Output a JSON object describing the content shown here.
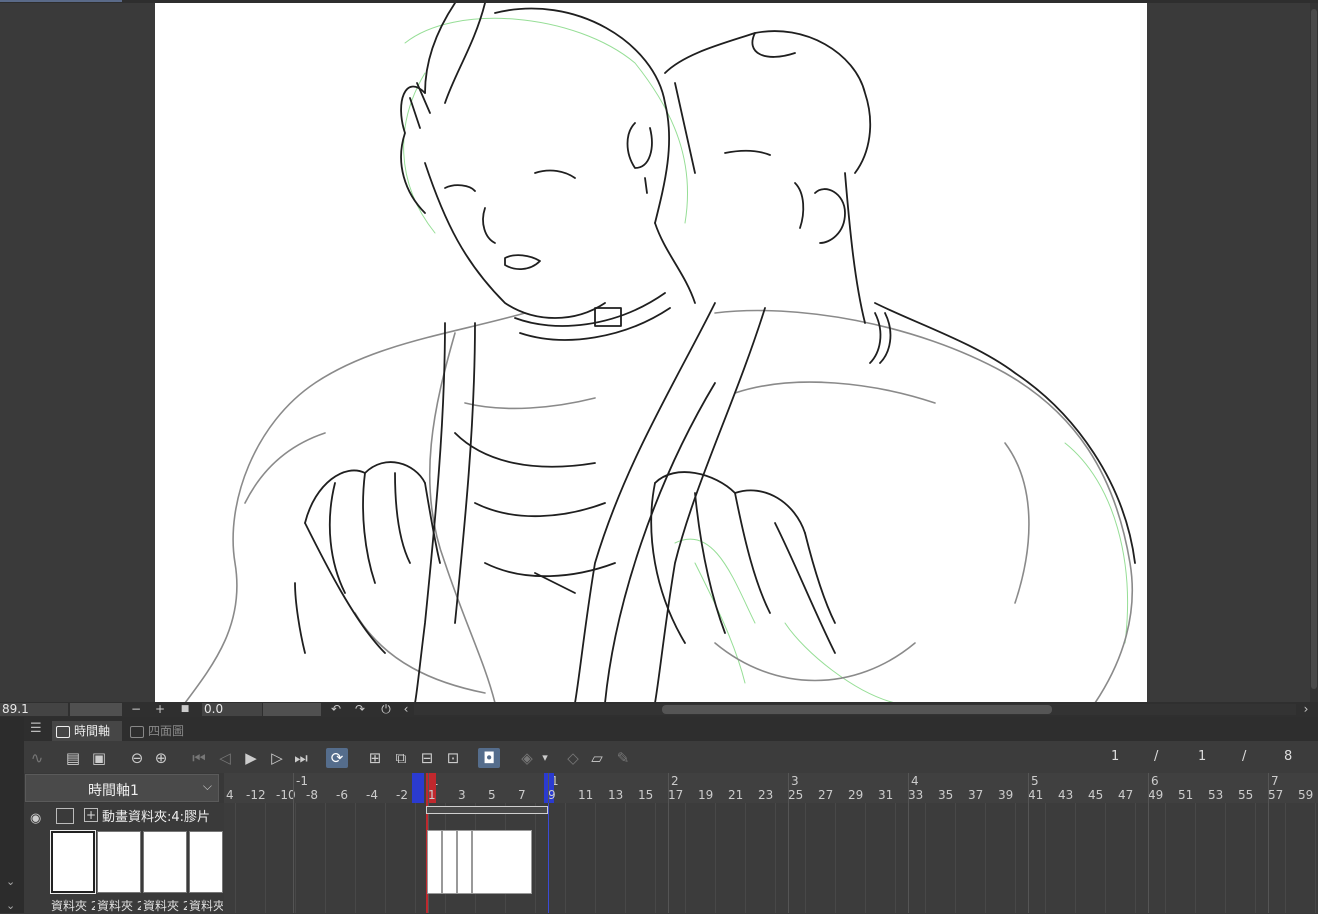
{
  "status_bar": {
    "zoom_value": "89.1",
    "rotation_value": "0.0",
    "zoom_out_glyph": "−",
    "zoom_in_glyph": "+",
    "fit_glyph": "■",
    "rotate_left_glyph": "↶",
    "rotate_right_glyph": "↷",
    "reset_rotation_glyph": "⏻",
    "scroll_left_glyph": "‹",
    "scroll_right_glyph": "›"
  },
  "timeline": {
    "menu_glyph": "☰",
    "tabs": [
      {
        "label": "時間軸",
        "active": true
      },
      {
        "label": "四面圖",
        "active": false
      }
    ],
    "selected_timeline": "時間軸1",
    "frame_counter": {
      "current": "1",
      "sep1": "/",
      "range": "1",
      "sep2": "/",
      "total": "8"
    },
    "layer": {
      "name": "動畫資料夾:4:膠片"
    },
    "thumb_captions": [
      "資料夾 2",
      "資料夾 2",
      "資料夾 2",
      "資料夾"
    ],
    "ruler": {
      "seconds": [
        {
          "label": "-1",
          "frame": -8
        },
        {
          "label": "1",
          "frame": 1
        },
        {
          "label": "1",
          "frame": 9
        },
        {
          "label": "2",
          "frame": 17
        },
        {
          "label": "3",
          "frame": 25
        },
        {
          "label": "4",
          "frame": 33
        },
        {
          "label": "5",
          "frame": 41
        },
        {
          "label": "6",
          "frame": 49
        },
        {
          "label": "7",
          "frame": 57
        }
      ],
      "frame_labels": [
        "4",
        "-12",
        "-10",
        "-8",
        "-6",
        "-4",
        "-2",
        "1",
        "3",
        "5",
        "7",
        "9",
        "11",
        "13",
        "15",
        "17",
        "19",
        "21",
        "23",
        "25",
        "27",
        "29",
        "31",
        "33",
        "35",
        "37",
        "39",
        "41",
        "43",
        "45",
        "47",
        "49",
        "51",
        "53",
        "55",
        "57",
        "59"
      ]
    },
    "playhead_frame": 1,
    "range_start": 1,
    "range_end": 9
  },
  "icons": {
    "eye": "eye-icon",
    "layer": "animation-folder-icon",
    "toolbar": [
      "curve-icon",
      "new-animation-folder-icon",
      "new-cel-icon",
      "zoom-out-icon",
      "zoom-in-icon",
      "go-first-icon",
      "prev-frame-icon",
      "play-icon",
      "next-frame-icon",
      "go-last-icon",
      "loop-icon",
      "add-cel-icon",
      "duplicate-cel-icon",
      "delete-cel-icon",
      "cel-options-icon",
      "onion-skin-icon",
      "camera-work-icon",
      "dropdown-icon",
      "light-table-icon",
      "edit-cel-icon",
      "pen-icon"
    ]
  },
  "colors": {
    "playhead": "#c0282d",
    "range_marker": "#2b3bd0",
    "active_toolbar": "#556d8c"
  }
}
